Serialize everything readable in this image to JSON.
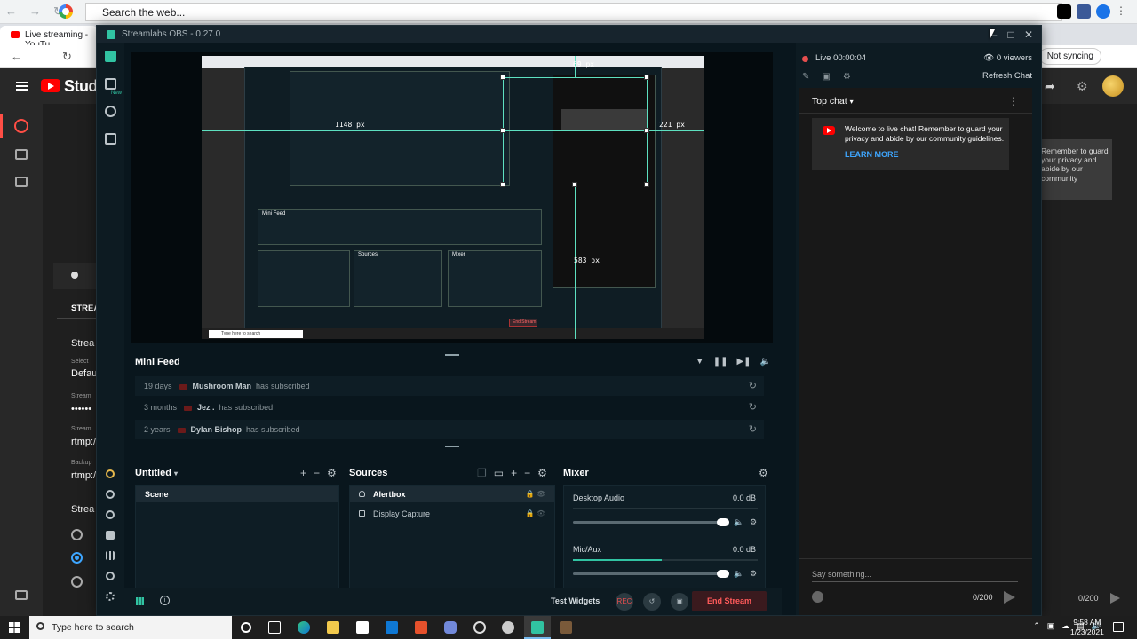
{
  "chrome": {
    "omnibox_text": "Search the web...",
    "tab_title": "Live streaming - YouTu",
    "not_syncing": "Not syncing"
  },
  "youtube": {
    "studio_text": "Studi",
    "stream_label": "STREA",
    "stream_heading": "Strea",
    "select_label": "Select",
    "default_value": "Defau",
    "stream_key_label": "Stream",
    "stream_key_value": "••••••",
    "stream_url_label": "Stream",
    "stream_url_value": "rtmp:/",
    "backup_label": "Backup",
    "backup_value": "rtmp:/",
    "stream_latency_heading": "Strea",
    "welcome_partial": "Remember to guard your privacy and abide by our community",
    "char_count": "0/200"
  },
  "streamlabs": {
    "title": "Streamlabs OBS - 0.27.0",
    "nav_new_badge": "New",
    "preview": {
      "label_top": "69 px",
      "label_left": "1148 px",
      "label_right": "221 px",
      "label_bottom": "583 px",
      "mini_feed": "Mini Feed",
      "sources": "Sources",
      "mixer": "Mixer",
      "end_stream": "End Stream",
      "search_text": "Type here to search"
    },
    "mini_feed": {
      "title": "Mini Feed",
      "events": [
        {
          "time": "19 days",
          "name": "Mushroom Man",
          "action": "has subscribed"
        },
        {
          "time": "3 months",
          "name": "Jez .",
          "action": "has subscribed"
        },
        {
          "time": "2 years",
          "name": "Dylan Bishop",
          "action": "has subscribed"
        }
      ]
    },
    "scenes": {
      "title": "Untitled",
      "items": [
        "Scene"
      ]
    },
    "sources": {
      "title": "Sources",
      "items": [
        "Alertbox",
        "Display Capture"
      ]
    },
    "mixer": {
      "title": "Mixer",
      "channels": [
        {
          "name": "Desktop Audio",
          "db": "0.0 dB",
          "level": 0
        },
        {
          "name": "Mic/Aux",
          "db": "0.0 dB",
          "level": 0.48
        }
      ]
    },
    "footer": {
      "test_widgets": "Test Widgets",
      "rec_label": "REC",
      "end_stream": "End Stream"
    },
    "chat": {
      "live_time": "Live 00:00:04",
      "viewers": "0 viewers",
      "refresh_chat": "Refresh Chat",
      "top_chat": "Top chat",
      "welcome_text": "Welcome to live chat! Remember to guard your privacy and abide by our community guidelines.",
      "learn_more": "LEARN MORE",
      "placeholder": "Say something...",
      "char_count": "0/200"
    }
  },
  "taskbar": {
    "search_text": "Type here to search",
    "time": "9:58 AM",
    "date": "1/23/2021"
  }
}
